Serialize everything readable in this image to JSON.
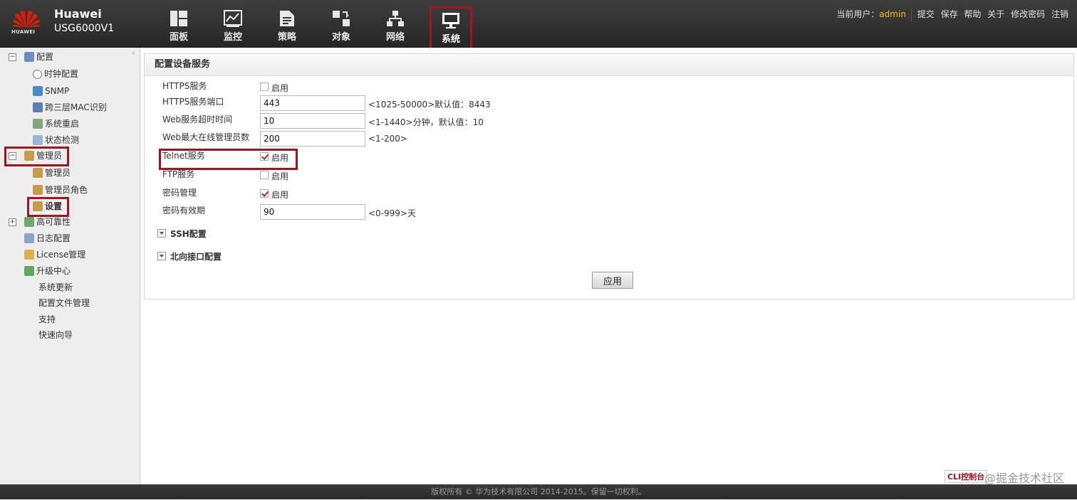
{
  "header": {
    "brand_line1": "Huawei",
    "brand_line2": "USG6000V1",
    "logo_text": "HUAWEI",
    "nav": [
      {
        "label": "面板",
        "icon": "dashboard-icon"
      },
      {
        "label": "监控",
        "icon": "monitor-chart-icon"
      },
      {
        "label": "策略",
        "icon": "policy-document-icon"
      },
      {
        "label": "对象",
        "icon": "object-icon"
      },
      {
        "label": "网络",
        "icon": "network-topology-icon"
      },
      {
        "label": "系统",
        "icon": "system-monitor-icon",
        "active": true
      }
    ],
    "current_user_label": "当前用户：",
    "current_user": "admin",
    "actions": [
      "提交",
      "保存",
      "帮助",
      "关于",
      "修改密码",
      "注销"
    ]
  },
  "sidebar": {
    "items": [
      {
        "label": "配置",
        "level": 0,
        "expander": "−"
      },
      {
        "label": "时钟配置",
        "level": 1
      },
      {
        "label": "SNMP",
        "level": 1
      },
      {
        "label": "跨三层MAC识别",
        "level": 1
      },
      {
        "label": "系统重启",
        "level": 1
      },
      {
        "label": "状态检测",
        "level": 1
      },
      {
        "label": "管理员",
        "level": 0,
        "expander": "−"
      },
      {
        "label": "管理员",
        "level": 1
      },
      {
        "label": "管理员角色",
        "level": 1
      },
      {
        "label": "设置",
        "level": 1,
        "selected": true
      },
      {
        "label": "高可靠性",
        "level": 0,
        "expander": "+"
      },
      {
        "label": "日志配置",
        "level": 0
      },
      {
        "label": "License管理",
        "level": 0
      },
      {
        "label": "升级中心",
        "level": 0
      },
      {
        "label": "系统更新",
        "level": 0
      },
      {
        "label": "配置文件管理",
        "level": 0
      },
      {
        "label": "支持",
        "level": 0
      },
      {
        "label": "快速向导",
        "level": 0
      }
    ]
  },
  "panel": {
    "title": "配置设备服务",
    "enable_label": "启用",
    "rows": {
      "https_service": {
        "label": "HTTPS服务",
        "checked": false
      },
      "https_port": {
        "label": "HTTPS服务端口",
        "value": "443",
        "hint": "<1025-50000>默认值：8443"
      },
      "web_timeout": {
        "label": "Web服务超时时间",
        "value": "10",
        "hint": "<1-1440>分钟，默认值：10"
      },
      "web_max_admins": {
        "label": "Web最大在线管理员数",
        "value": "200",
        "hint": "<1-200>"
      },
      "telnet_service": {
        "label": "Telnet服务",
        "checked": true
      },
      "ftp_service": {
        "label": "FTP服务",
        "checked": false
      },
      "password_mgmt": {
        "label": "密码管理",
        "checked": true
      },
      "password_validity": {
        "label": "密码有效期",
        "value": "90",
        "hint": "<0-999>天"
      }
    },
    "sections": {
      "ssh": "SSH配置",
      "northbound": "北向接口配置"
    },
    "apply_label": "应用"
  },
  "footer": {
    "copyright": "版权所有 © 华为技术有限公司 2014-2015。保留一切权利。",
    "watermark": "@掘金技术社区",
    "badge": "CLI控制台"
  },
  "colors": {
    "highlight": "#a4141c",
    "user": "#f2c200",
    "header_bg": "#2e2e2e"
  }
}
